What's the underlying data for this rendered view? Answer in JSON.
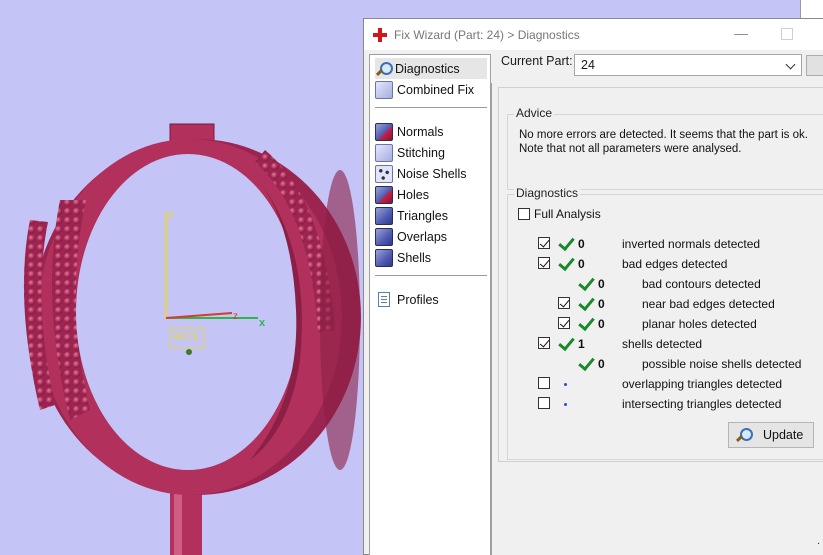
{
  "viewport": {
    "axis_labels": {
      "x": "x",
      "y": "y",
      "z": "z"
    },
    "wcs_label": "WCS",
    "colors": {
      "background": "#c4c4f7",
      "model": "#b1305c",
      "model_dark": "#8c1f45"
    }
  },
  "window": {
    "title": "Fix Wizard (Part: 24) > Diagnostics",
    "minimize_glyph": "—"
  },
  "nav": {
    "groups": [
      [
        {
          "label": "Diagnostics",
          "icon": "magnifier-icon",
          "selected": true
        },
        {
          "label": "Combined Fix",
          "icon": "cube-light-icon",
          "selected": false
        }
      ],
      [
        {
          "label": "Normals",
          "icon": "cube-red-icon"
        },
        {
          "label": "Stitching",
          "icon": "cube-icon"
        },
        {
          "label": "Noise Shells",
          "icon": "dots-cube-icon"
        },
        {
          "label": "Holes",
          "icon": "cube-red-icon"
        },
        {
          "label": "Triangles",
          "icon": "cube-icon"
        },
        {
          "label": "Overlaps",
          "icon": "cube-icon"
        },
        {
          "label": "Shells",
          "icon": "cube-icon"
        }
      ],
      [
        {
          "label": "Profiles",
          "icon": "document-icon"
        }
      ]
    ]
  },
  "current_part": {
    "label": "Current Part:",
    "value": "24"
  },
  "advice": {
    "title": "Advice",
    "lines": [
      "No more errors are detected. It seems that the part is ok.",
      "Note that not all parameters were analysed."
    ]
  },
  "diagnostics": {
    "title": "Diagnostics",
    "full_analysis": {
      "label": "Full Analysis",
      "checked": false
    },
    "rows": [
      {
        "checkbox": true,
        "checked": true,
        "status": "ok",
        "count": "0",
        "label": "inverted normals detected",
        "level": 0
      },
      {
        "checkbox": true,
        "checked": true,
        "status": "ok",
        "count": "0",
        "label": "bad edges detected",
        "level": 0
      },
      {
        "checkbox": false,
        "checked": false,
        "status": "ok",
        "count": "0",
        "label": "bad contours detected",
        "level": 1
      },
      {
        "checkbox": true,
        "checked": true,
        "status": "ok",
        "count": "0",
        "label": "near bad edges detected",
        "level": 1
      },
      {
        "checkbox": true,
        "checked": true,
        "status": "ok",
        "count": "0",
        "label": "planar holes detected",
        "level": 1
      },
      {
        "checkbox": true,
        "checked": true,
        "status": "ok",
        "count": "1",
        "label": "shells detected",
        "level": 0
      },
      {
        "checkbox": false,
        "checked": false,
        "status": "ok",
        "count": "0",
        "label": "possible noise shells detected",
        "level": 1
      },
      {
        "checkbox": true,
        "checked": false,
        "status": "pending",
        "count": "",
        "label": "overlapping triangles detected",
        "level": 0
      },
      {
        "checkbox": true,
        "checked": false,
        "status": "pending",
        "count": "",
        "label": "intersecting triangles detected",
        "level": 0
      }
    ],
    "update_label": "Update"
  },
  "edge_glyph": "."
}
